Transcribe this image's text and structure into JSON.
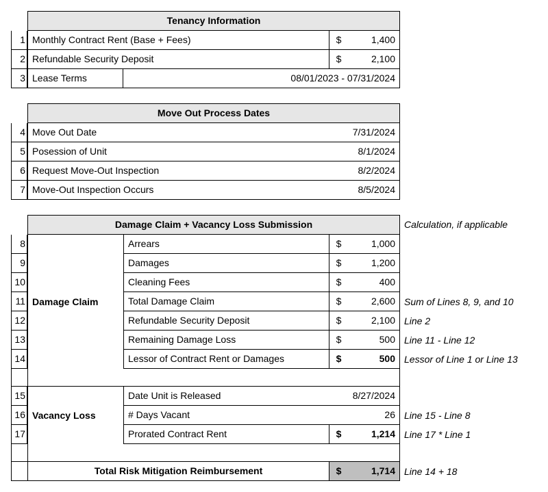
{
  "tenancy": {
    "header": "Tenancy Information",
    "rows": [
      {
        "n": "1",
        "label": "Monthly Contract Rent (Base + Fees)",
        "cur": "$",
        "val": "1,400"
      },
      {
        "n": "2",
        "label": "Refundable Security Deposit",
        "cur": "$",
        "val": "2,100"
      }
    ],
    "lease_n": "3",
    "lease_label": "Lease Terms",
    "lease_val": "08/01/2023 - 07/31/2024"
  },
  "moveout": {
    "header": "Move Out Process Dates",
    "rows": [
      {
        "n": "4",
        "label": "Move Out Date",
        "val": "7/31/2024"
      },
      {
        "n": "5",
        "label": "Posession of Unit",
        "val": "8/1/2024"
      },
      {
        "n": "6",
        "label": "Request Move-Out Inspection",
        "val": "8/2/2024"
      },
      {
        "n": "7",
        "label": "Move-Out Inspection Occurs",
        "val": "8/5/2024"
      }
    ]
  },
  "claim": {
    "header": "Damage Claim + Vacancy Loss Submission",
    "calc_header": "Calculation, if applicable",
    "damage_label": "Damage Claim",
    "vacancy_label": "Vacancy Loss",
    "rows": {
      "r8": {
        "n": "8",
        "label": "Arrears",
        "cur": "$",
        "val": "1,000",
        "calc": ""
      },
      "r9": {
        "n": "9",
        "label": "Damages",
        "cur": "$",
        "val": "1,200",
        "calc": ""
      },
      "r10": {
        "n": "10",
        "label": "Cleaning Fees",
        "cur": "$",
        "val": "400",
        "calc": ""
      },
      "r11": {
        "n": "11",
        "label": "Total Damage Claim",
        "cur": "$",
        "val": "2,600",
        "calc": "Sum of Lines 8, 9, and 10"
      },
      "r12": {
        "n": "12",
        "label": "Refundable Security Deposit",
        "cur": "$",
        "val": "2,100",
        "calc": "Line 2"
      },
      "r13": {
        "n": "13",
        "label": "Remaining Damage Loss",
        "cur": "$",
        "val": "500",
        "calc": "Line 11 - Line 12"
      },
      "r14": {
        "n": "14",
        "label": "Lessor of Contract Rent or Damages",
        "cur": "$",
        "val": "500",
        "calc": "Lessor of Line 1 or Line 13"
      },
      "r15": {
        "n": "15",
        "label": "Date Unit is Released",
        "val": "8/27/2024",
        "calc": ""
      },
      "r16": {
        "n": "16",
        "label": "# Days Vacant",
        "val": "26",
        "calc": "Line 15 - Line 8"
      },
      "r17": {
        "n": "17",
        "label": "Prorated Contract Rent",
        "cur": "$",
        "val": "1,214",
        "calc": "Line 17 * Line 1"
      }
    },
    "total_label": "Total Risk Mitigation Reimbursement",
    "total_cur": "$",
    "total_val": "1,714",
    "total_calc": "Line 14 + 18"
  }
}
